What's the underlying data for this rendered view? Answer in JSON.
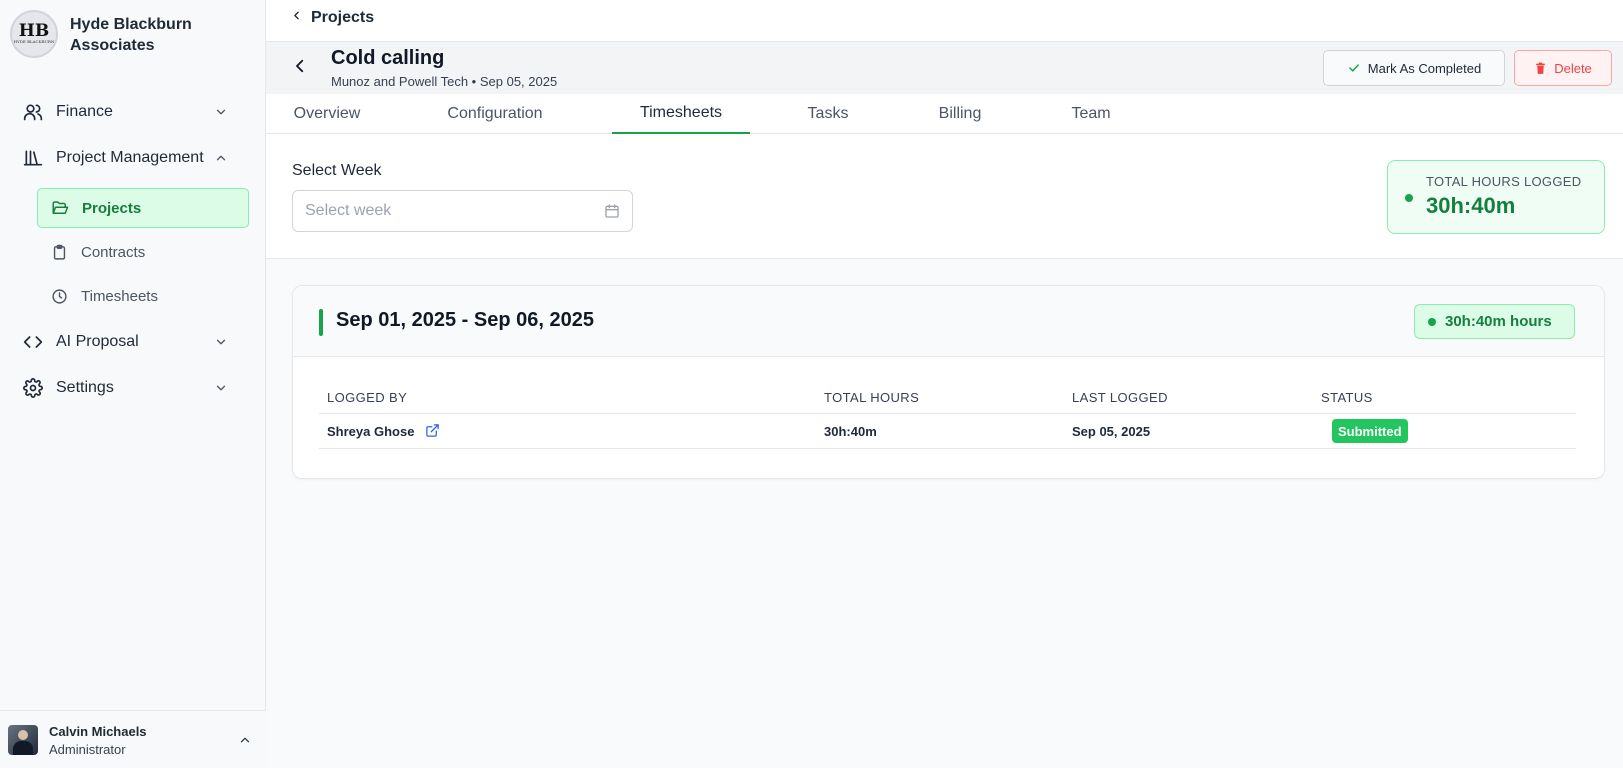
{
  "brand": {
    "monogram": "HB",
    "logo_text": "HYDE BLACKBURN",
    "name": "Hyde Blackburn Associates"
  },
  "sidebar": {
    "items": [
      {
        "label": "Finance",
        "icon": "users-icon"
      },
      {
        "label": "Project Management",
        "icon": "library-icon"
      },
      {
        "label": "AI Proposal",
        "icon": "code-icon"
      },
      {
        "label": "Settings",
        "icon": "gear-icon"
      }
    ],
    "sub_items": [
      {
        "label": "Projects",
        "icon": "folder-open-icon",
        "active": true
      },
      {
        "label": "Contracts",
        "icon": "clipboard-icon"
      },
      {
        "label": "Timesheets",
        "icon": "clock-icon"
      }
    ]
  },
  "user": {
    "name": "Calvin Michaels",
    "role": "Administrator"
  },
  "topbar": {
    "breadcrumb": "Projects"
  },
  "project": {
    "title": "Cold calling",
    "subtitle": "Munoz and Powell Tech • Sep 05, 2025",
    "mark_completed_label": "Mark As Completed",
    "delete_label": "Delete"
  },
  "tabs": [
    {
      "label": "Overview"
    },
    {
      "label": "Configuration"
    },
    {
      "label": "Timesheets",
      "active": true
    },
    {
      "label": "Tasks"
    },
    {
      "label": "Billing"
    },
    {
      "label": "Team"
    }
  ],
  "week_select": {
    "label": "Select Week",
    "placeholder": "Select week"
  },
  "total_hours": {
    "caption": "TOTAL HOURS LOGGED",
    "value": "30h:40m"
  },
  "week_card": {
    "range": "Sep 01, 2025 - Sep 06, 2025",
    "badge": "30h:40m hours",
    "columns": [
      "LOGGED BY",
      "TOTAL HOURS",
      "LAST LOGGED",
      "STATUS"
    ],
    "rows": [
      {
        "logged_by": "Shreya Ghose",
        "total_hours": "30h:40m",
        "last_logged": "Sep 05, 2025",
        "status": "Submitted"
      }
    ]
  },
  "colors": {
    "accent_green": "#16a34a",
    "delete_red": "#ef4444",
    "status_submitted": "#22c55e"
  }
}
